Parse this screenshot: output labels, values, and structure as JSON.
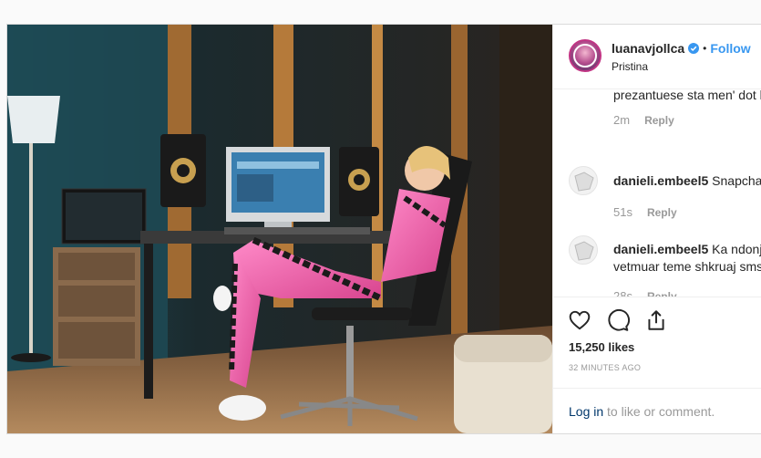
{
  "post": {
    "username": "luanavjollca",
    "separator": "•",
    "follow_label": "Follow",
    "location": "Pristina"
  },
  "comments": {
    "cut_text": "prezantuese sta men' dot k",
    "first_meta": {
      "time": "2m",
      "reply": "Reply"
    },
    "items": [
      {
        "user": "danieli.embeel5",
        "text": " Snapchat",
        "line2": "",
        "time": "51s",
        "reply": "Reply"
      },
      {
        "user": "danieli.embeel5",
        "text": " Ka ndonje",
        "line2": "vetmuar teme shkruaj sms",
        "time": "28s",
        "reply": "Reply"
      }
    ]
  },
  "actions": {
    "like": "heart-icon",
    "comment": "comment-icon",
    "share": "share-icon"
  },
  "likes": "15,250 likes",
  "time_ago": "32 MINUTES AGO",
  "login": {
    "link": "Log in",
    "rest": " to like or comment."
  },
  "colors": {
    "follow": "#3897f0",
    "muted": "#999999",
    "pink": "#e65fa8"
  }
}
